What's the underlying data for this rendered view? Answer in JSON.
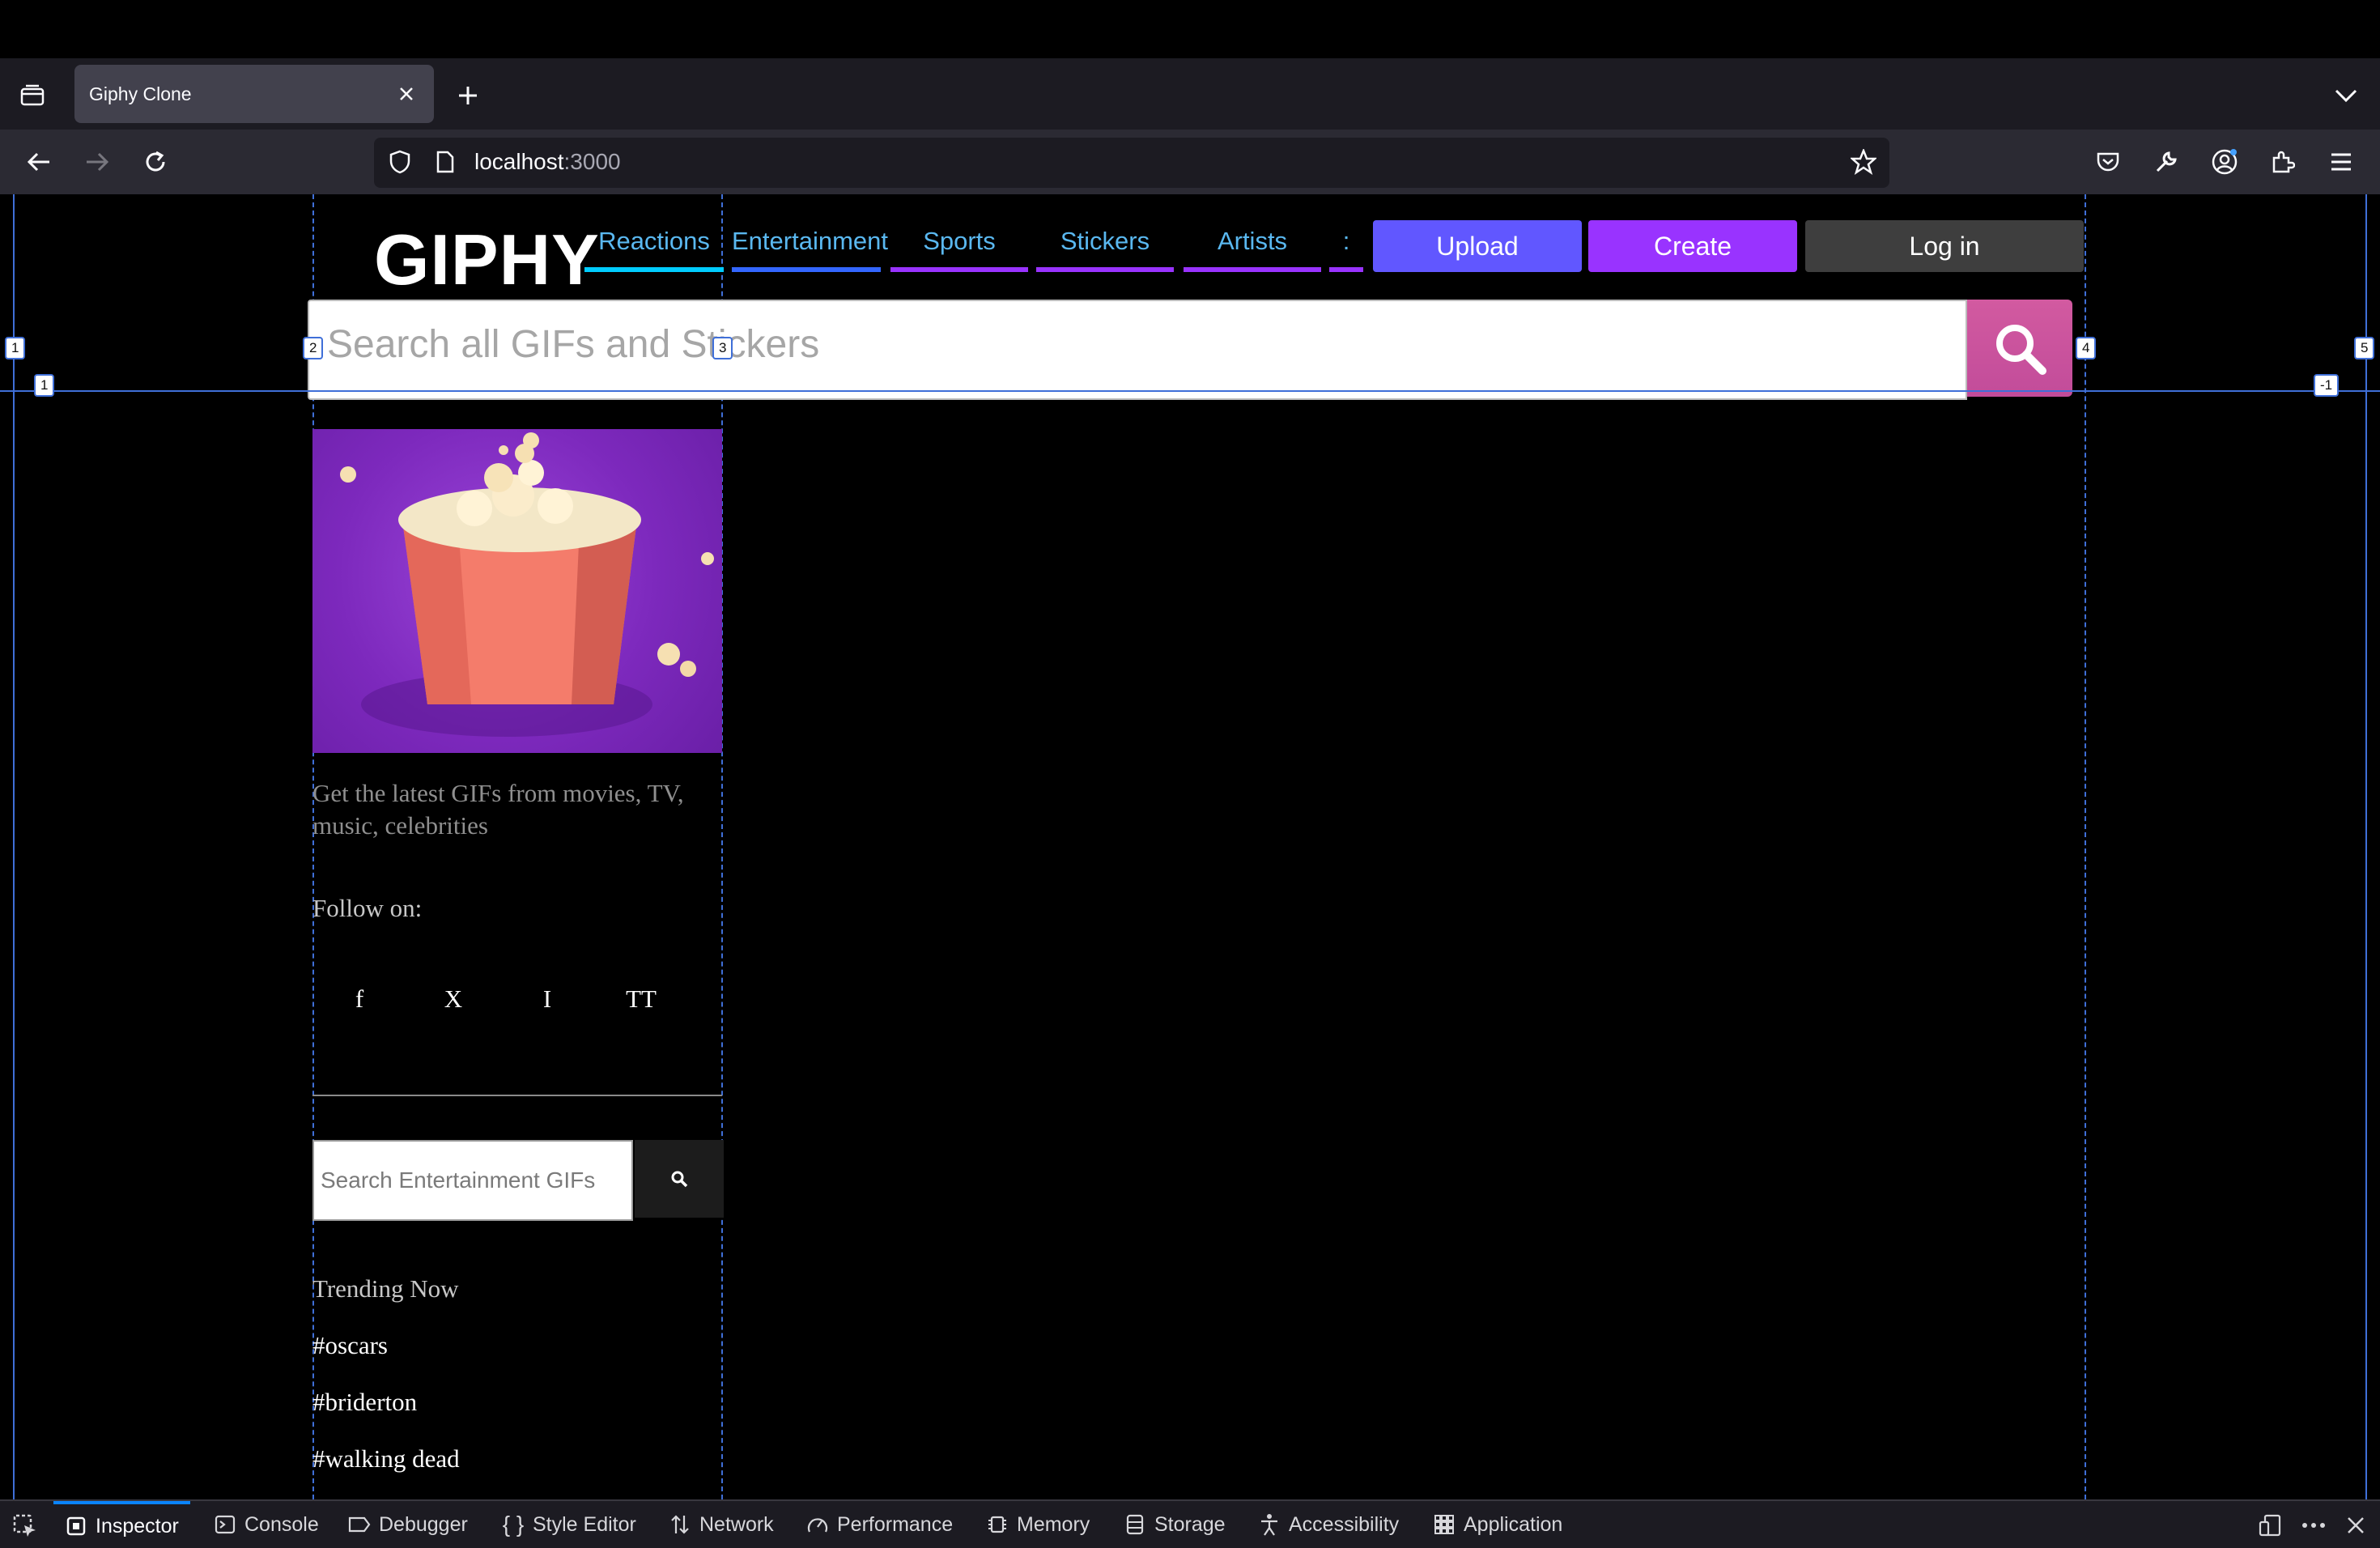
{
  "browser": {
    "tab_title": "Giphy Clone",
    "url_host": "localhost",
    "url_port": ":3000"
  },
  "header": {
    "logo": "GIPHY",
    "categories": [
      {
        "label": "Reactions",
        "color": "#00ccff"
      },
      {
        "label": "Entertainment",
        "color": "#3366ff"
      },
      {
        "label": "Sports",
        "color": "#9933ff"
      },
      {
        "label": "Stickers",
        "color": "#9933ff"
      },
      {
        "label": "Artists",
        "color": "#9933ff"
      },
      {
        "label": ":",
        "color": "#9933ff"
      }
    ],
    "upload_label": "Upload",
    "create_label": "Create",
    "login_label": "Log in"
  },
  "search": {
    "placeholder": "Search all GIFs and Stickers"
  },
  "sidebar": {
    "description": "Get the latest GIFs from movies, TV, music, celebrities",
    "follow_label": "Follow on:",
    "socials": [
      "f",
      "X",
      "I",
      "TT"
    ],
    "search_placeholder": "Search Entertainment GIFs",
    "trending_title": "Trending Now",
    "trending": [
      "#oscars",
      "#briderton",
      "#walking dead"
    ]
  },
  "grid_overlay": {
    "column_labels": [
      "1",
      "2",
      "3",
      "4",
      "5"
    ],
    "row_labels": [
      "1",
      "-1"
    ]
  },
  "devtools": {
    "tabs": [
      "Inspector",
      "Console",
      "Debugger",
      "Style Editor",
      "Network",
      "Performance",
      "Memory",
      "Storage",
      "Accessibility",
      "Application"
    ],
    "active_tab": "Inspector"
  },
  "colors": {
    "upload": "#6157ff",
    "create": "#9933ff",
    "login": "#3e3e3e",
    "search_button": "#c24c9a",
    "grid_overlay": "#3f6fd8"
  }
}
